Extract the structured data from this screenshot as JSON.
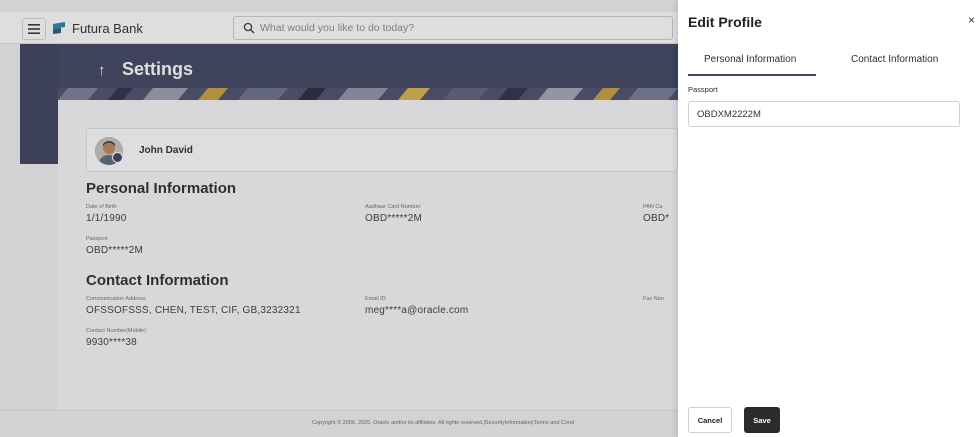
{
  "header": {
    "brand": "Futura Bank",
    "search_placeholder": "What would you like to do today?"
  },
  "page": {
    "back_arrow": "↑",
    "title": "Settings"
  },
  "profile": {
    "name": "John David"
  },
  "personal": {
    "heading": "Personal Information",
    "dob_label": "Date of Birth",
    "dob_value": "1/1/1990",
    "aadhaar_label": "Aadhaar Card Number",
    "aadhaar_value": "OBD*****2M",
    "pan_label": "PAN Ca",
    "pan_value": "OBD*",
    "passport_label": "Passport",
    "passport_value": "OBD*****2M"
  },
  "contact": {
    "heading": "Contact Information",
    "address_label": "Communication Address",
    "address_value": "OFSSOFSSS, CHEN, TEST, CIF, GB,3232321",
    "email_label": "Email ID",
    "email_value": "meg****a@oracle.com",
    "fax_label": "Fax Nun",
    "mobile_label": "Contact Number(Mobile)",
    "mobile_value": "9930****38"
  },
  "footer": {
    "copyright": "Copyright © 2006, 2025, Oracle and/or its affiliates. All rights reserved.|SecurityInformation|Terms and Cond"
  },
  "drawer": {
    "title": "Edit Profile",
    "close": "×",
    "tabs": [
      {
        "label": "Personal Information",
        "active": true
      },
      {
        "label": "Contact Information",
        "active": false
      }
    ],
    "passport_label": "Passport",
    "passport_value": "OBDXM2222M",
    "cancel_label": "Cancel",
    "save_label": "Save"
  },
  "colors": {
    "banner": "#3e425f",
    "accent": "#3f4266",
    "save_button": "#2b2b2b"
  },
  "icons": [
    "hamburger-icon",
    "bank-logo-icon",
    "search-icon",
    "back-arrow-icon",
    "avatar",
    "edit-badge-icon",
    "close-icon"
  ]
}
